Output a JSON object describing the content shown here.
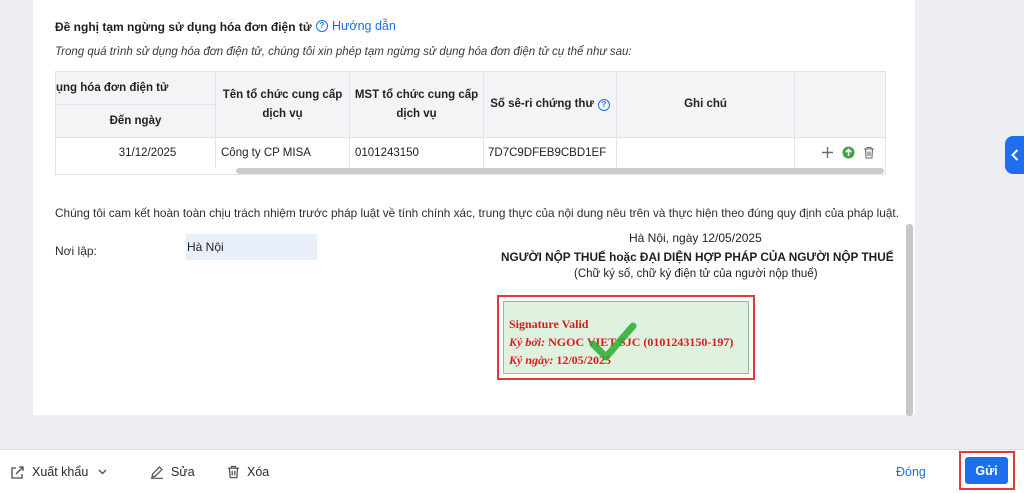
{
  "section": {
    "title": "Đề nghị tạm ngừng sử dụng hóa đơn điện tử",
    "help_label": "Hướng dẫn",
    "intro": "Trong quá trình sử dụng hóa đơn điện tử, chúng tôi xin phép tạm ngừng sử dụng hóa đơn điện tử cụ thể như sau:"
  },
  "table": {
    "group_header": "ụng hóa đơn điện tử",
    "col_to_date": "Đến ngày",
    "col_provider": "Tên tổ chức cung cấp dịch vụ",
    "col_tax_id": "MST tổ chức cung cấp dịch vụ",
    "col_serial": "Số sê-ri chứng thư",
    "col_note": "Ghi chú",
    "row": {
      "to_date": "31/12/2025",
      "provider": "Công ty CP MISA",
      "tax_id": "0101243150",
      "serial": "7D7C9DFEB9CBD1EF",
      "note": ""
    }
  },
  "commitment": "Chúng tôi cam kết hoàn toàn chịu trách nhiệm trước pháp luật về tính chính xác, trung thực của nội dung nêu trên và thực hiện theo đúng quy định của pháp luật.",
  "place": {
    "label": "Nơi lập:",
    "value": "Hà Nội"
  },
  "signature": {
    "date_line": "Hà Nội, ngày 12/05/2025",
    "role": "NGƯỜI NỘP THUẾ hoặc ĐẠI DIỆN HỢP PHÁP CỦA NGƯỜI NỘP THUẾ",
    "note": "(Chữ ký số, chữ ký điện tử của người nộp thuế)",
    "status": "Signature Valid",
    "signed_by_label": "Ký bởi:",
    "signed_by": "NGOC VIET SJC (0101243150-197)",
    "signed_date_label": "Ký ngày:",
    "signed_date": "12/05/2025"
  },
  "footer": {
    "export_label": "Xuất khẩu",
    "edit_label": "Sửa",
    "delete_label": "Xóa",
    "close_label": "Đóng",
    "send_label": "Gửi"
  },
  "colors": {
    "accent": "#1e6ff0",
    "highlight": "#e53935",
    "signature_bg": "#dff2df"
  }
}
